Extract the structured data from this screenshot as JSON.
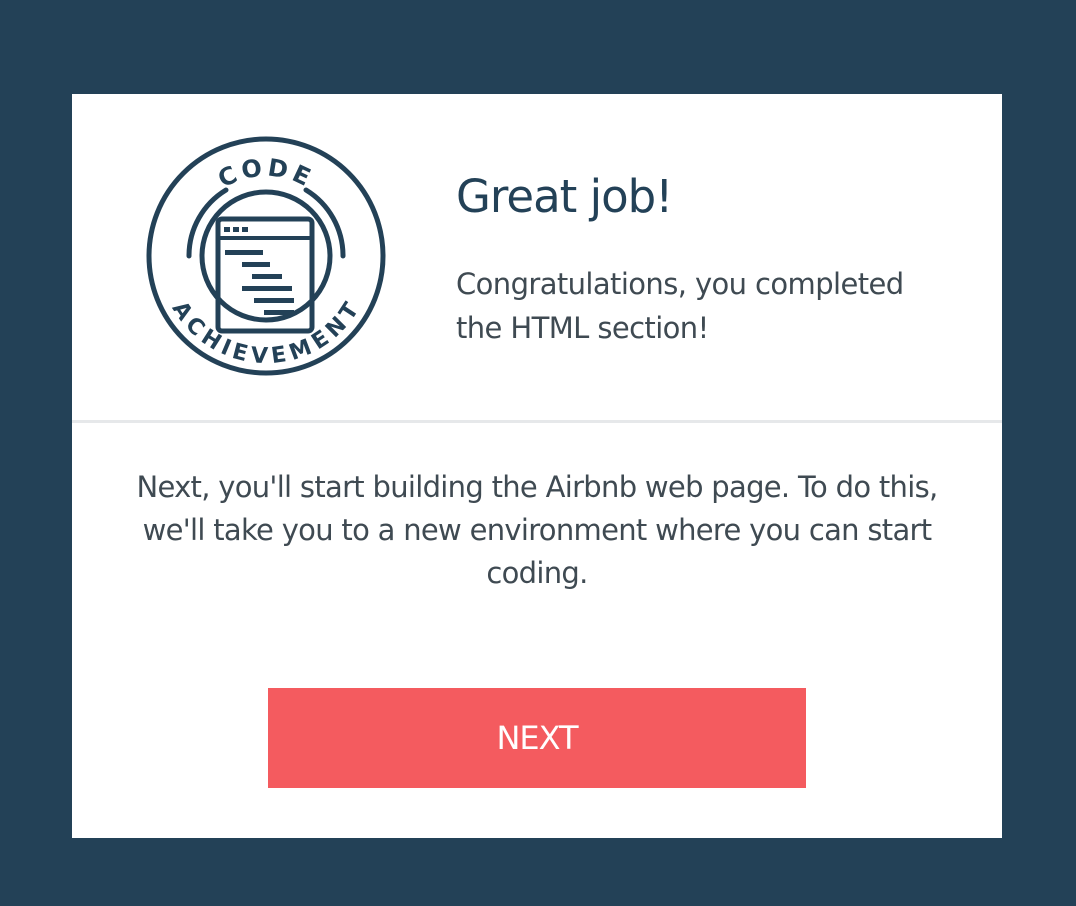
{
  "colors": {
    "background": "#234157",
    "panel": "#ffffff",
    "heading": "#234157",
    "text": "#3f4a52",
    "button": "#f45b5f",
    "divider": "#e6e8ea"
  },
  "badge": {
    "icon": "code-achievement-badge",
    "top_text": "CODE",
    "bottom_text": "ACHIEVEMENT"
  },
  "header": {
    "title": "Great job!",
    "subtitle": "Congratulations, you completed the HTML section!"
  },
  "message": "Next, you'll start building the Airbnb web page. To do this, we'll take you to a new environment where you can start coding.",
  "actions": {
    "next_label": "NEXT"
  }
}
